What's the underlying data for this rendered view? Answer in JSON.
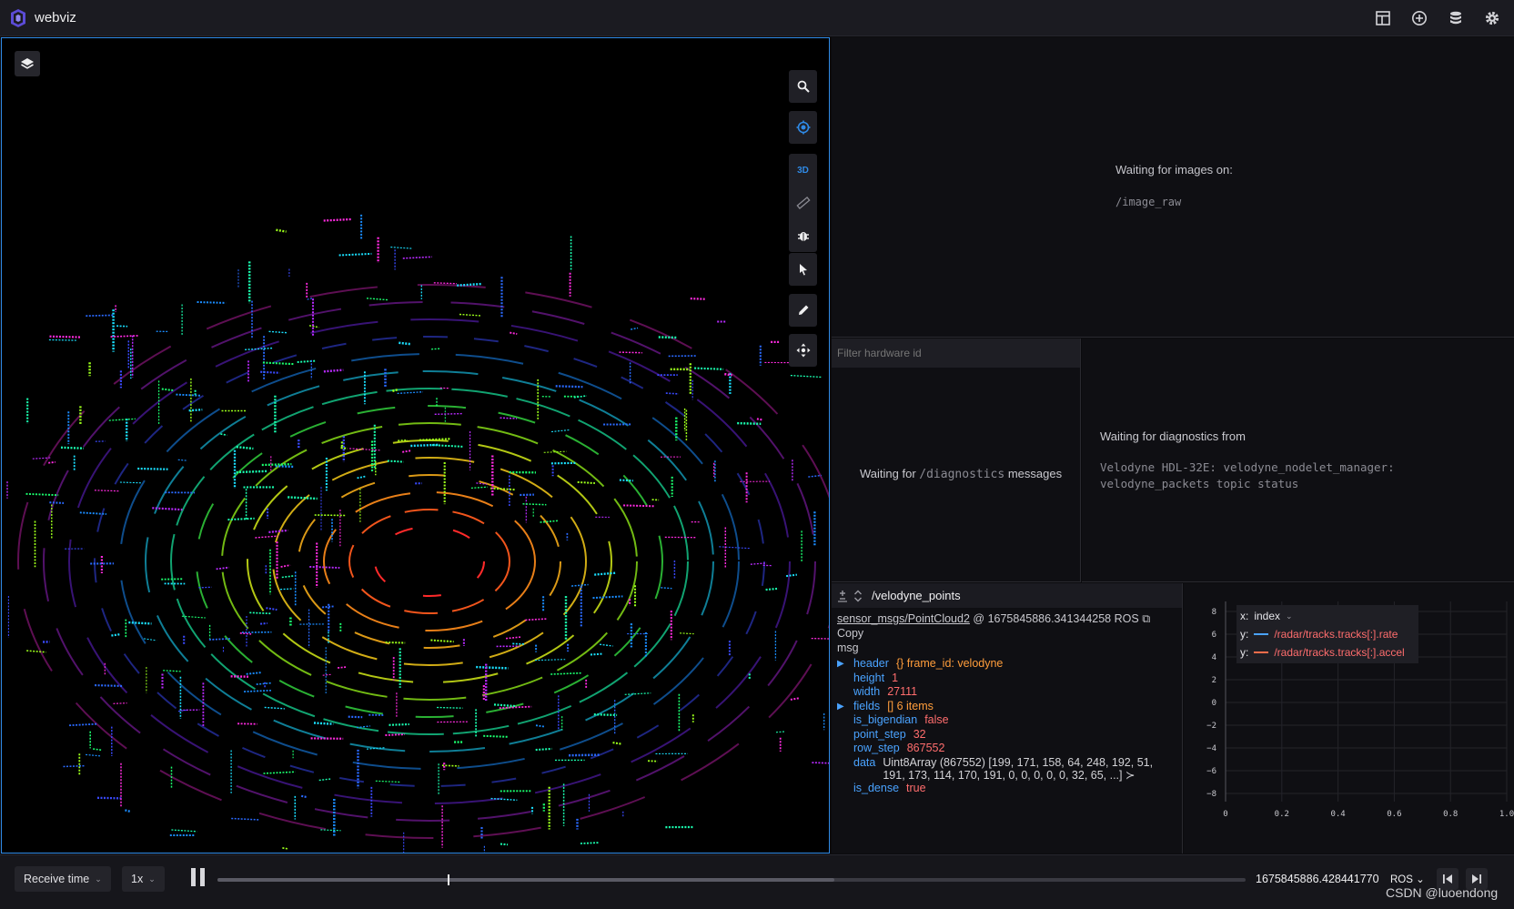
{
  "app": {
    "title": "webviz"
  },
  "toolbar_icons": [
    "layout-icon",
    "add-panel-icon",
    "data-source-icon",
    "settings-icon"
  ],
  "viewport": {
    "tools": [
      "search-icon",
      "target-icon",
      "3d-toggle",
      "ruler-icon",
      "bug-icon",
      "cursor-icon",
      "pencil-icon",
      "move-icon"
    ],
    "mode_label": "3D",
    "colors": {
      "active": "#2f8ae6"
    }
  },
  "image_panel": {
    "waiting": "Waiting for images on:",
    "topic": "/image_raw"
  },
  "diagnostics_list": {
    "filter_placeholder": "Filter hardware id",
    "wait_prefix": "Waiting for",
    "wait_topic": "/diagnostics",
    "wait_suffix": "messages"
  },
  "diagnostics_detail": {
    "waiting": "Waiting for diagnostics from",
    "source": "Velodyne HDL-32E: velodyne_nodelet_manager: velodyne_packets topic status"
  },
  "raw_messages": {
    "topic": "/velodyne_points",
    "datatype": "sensor_msgs/PointCloud2",
    "stamp": "@ 1675845886.341344258 ROS",
    "copy": "Copy",
    "msg_label": "msg",
    "fields": [
      {
        "key": "header",
        "expandable": true,
        "value": "{} frame_id: velodyne",
        "kind": "str"
      },
      {
        "key": "height",
        "expandable": false,
        "value": "1",
        "kind": "num"
      },
      {
        "key": "width",
        "expandable": false,
        "value": "27111",
        "kind": "num"
      },
      {
        "key": "fields",
        "expandable": true,
        "value": "[] 6 items",
        "kind": "str"
      },
      {
        "key": "is_bigendian",
        "expandable": false,
        "value": "false",
        "kind": "num"
      },
      {
        "key": "point_step",
        "expandable": false,
        "value": "32",
        "kind": "num"
      },
      {
        "key": "row_step",
        "expandable": false,
        "value": "867552",
        "kind": "num"
      },
      {
        "key": "data",
        "expandable": false,
        "value": "Uint8Array (867552) [199, 171, 158, 64, 248, 192, 51, 191, 173, 114, 170, 191, 0, 0, 0, 0, 0, 32, 65, ...] ≻",
        "kind": "plain"
      },
      {
        "key": "is_dense",
        "expandable": false,
        "value": "true",
        "kind": "num"
      }
    ]
  },
  "plot": {
    "x_label": "x:",
    "x_value": "index",
    "series": [
      {
        "prefix": "y:",
        "name": "/radar/tracks.tracks[:].rate",
        "color": "#4aa3ff"
      },
      {
        "prefix": "y:",
        "name": "/radar/tracks.tracks[:].accel",
        "color": "#ff6d4a"
      }
    ],
    "y_ticks": [
      "8",
      "6",
      "4",
      "2",
      "0",
      "−2",
      "−4",
      "−6",
      "−8"
    ],
    "x_ticks": [
      "0",
      "0.2",
      "0.4",
      "0.6",
      "0.8",
      "1.0"
    ]
  },
  "playback": {
    "time_source": "Receive time",
    "speed": "1x",
    "timestamp": "1675845886.428441770",
    "time_format": "ROS",
    "progress": 0.224,
    "buffered": 0.6
  },
  "watermark": "CSDN @luoendong"
}
